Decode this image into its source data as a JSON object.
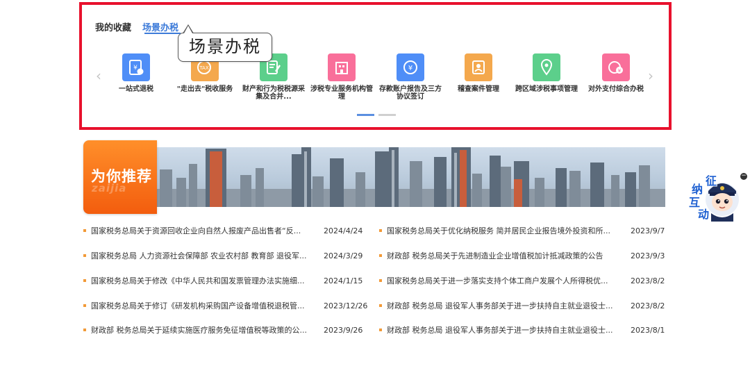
{
  "tabs": [
    {
      "label": "我的收藏",
      "active": false
    },
    {
      "label": "场景办税",
      "active": true
    }
  ],
  "tooltip": "场景办税",
  "nav": {
    "prev": "‹",
    "next": "›"
  },
  "scene_items": [
    {
      "label": "一站式退税",
      "color": "#4f8ef7",
      "icon": "tax-refund-icon"
    },
    {
      "label": "\"走出去\"税收服务",
      "color": "#f4a84d",
      "icon": "going-out-tax-icon"
    },
    {
      "label": "财产和行为税税源采集及合并...",
      "color": "#5ccf8b",
      "icon": "property-tax-icon"
    },
    {
      "label": "涉税专业服务机构管理",
      "color": "#f96f9a",
      "icon": "building-icon"
    },
    {
      "label": "存款账户报告及三方协议签订",
      "color": "#4f8ef7",
      "icon": "deposit-account-icon"
    },
    {
      "label": "稽查案件管理",
      "color": "#f4a84d",
      "icon": "case-management-icon"
    },
    {
      "label": "跨区域涉税事项管理",
      "color": "#5ccf8b",
      "icon": "location-icon"
    },
    {
      "label": "对外支付综合办税",
      "color": "#f96f9a",
      "icon": "foreign-payment-icon"
    }
  ],
  "pagination": {
    "pages": 2,
    "current": 1
  },
  "recommend": {
    "title": "为你推荐",
    "watermark": "zaijia"
  },
  "news_left": [
    {
      "title": "国家税务总局关于资源回收企业向自然人报废产品出售者“反...",
      "date": "2024/4/24"
    },
    {
      "title": "国家税务总局 人力资源社会保障部 农业农村部 教育部 退役军...",
      "date": "2024/3/29"
    },
    {
      "title": "国家税务总局关于修改《中华人民共和国发票管理办法实施细...",
      "date": "2024/1/15"
    },
    {
      "title": "国家税务总局关于修订《研发机构采购国产设备增值税退税管...",
      "date": "2023/12/26"
    },
    {
      "title": "财政部 税务总局关于延续实施医疗服务免征增值税等政策的公...",
      "date": "2023/9/26"
    }
  ],
  "news_right": [
    {
      "title": "国家税务总局关于优化纳税服务 简并居民企业报告境外投资和所...",
      "date": "2023/9/7"
    },
    {
      "title": "财政部 税务总局关于先进制造业企业增值税加计抵减政策的公告",
      "date": "2023/9/3"
    },
    {
      "title": "国家税务总局关于进一步落实支持个体工商户发展个人所得税优...",
      "date": "2023/8/2"
    },
    {
      "title": "财政部 税务总局 退役军人事务部关于进一步扶持自主就业退役士...",
      "date": "2023/8/2"
    },
    {
      "title": "财政部 税务总局 退役军人事务部关于进一步扶持自主就业退役士...",
      "date": "2023/8/1"
    }
  ],
  "widget": {
    "chars": [
      "征",
      "纳",
      "互",
      "动"
    ],
    "close": "−"
  }
}
